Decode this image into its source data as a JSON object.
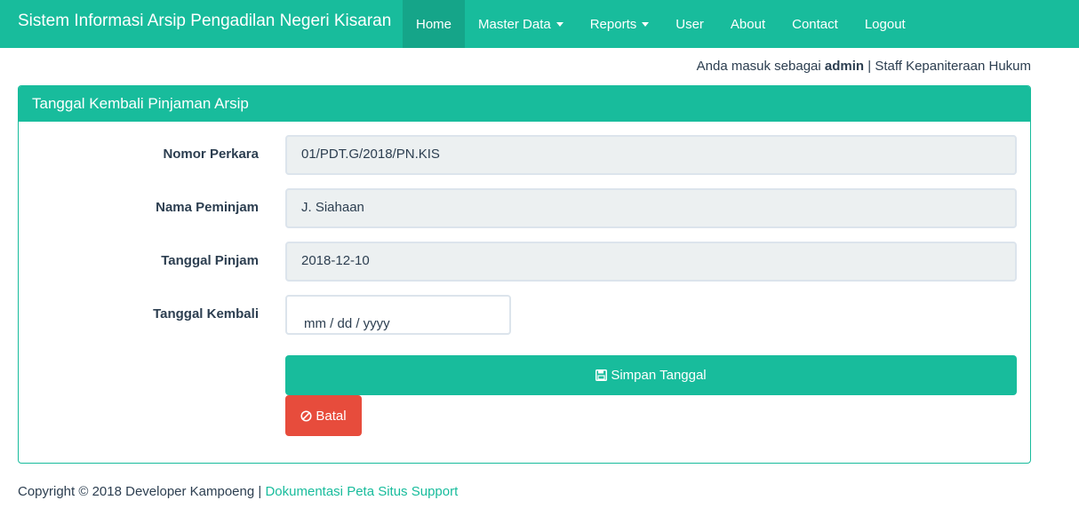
{
  "navbar": {
    "brand": "Sistem Informasi Arsip Pengadilan Negeri Kisaran",
    "items": [
      {
        "label": "Home",
        "active": true
      },
      {
        "label": "Master Data",
        "dropdown": true
      },
      {
        "label": "Reports",
        "dropdown": true
      },
      {
        "label": "User"
      },
      {
        "label": "About"
      },
      {
        "label": "Contact"
      },
      {
        "label": "Logout"
      }
    ]
  },
  "user": {
    "prefix": "Anda masuk sebagai",
    "name": "admin",
    "separator": "|",
    "role": "Staff Kepaniteraan Hukum"
  },
  "panel": {
    "title": "Tanggal Kembali Pinjaman Arsip",
    "fields": [
      {
        "label": "Nomor Perkara",
        "value": "01/PDT.G/2018/PN.KIS"
      },
      {
        "label": "Nama Peminjam",
        "value": "J. Siahaan"
      },
      {
        "label": "Tanggal Pinjam",
        "value": "2018-12-10"
      }
    ],
    "return_date": {
      "label": "Tanggal Kembali",
      "placeholder": "mm / dd / yyyy"
    },
    "save_button": {
      "label": "Simpan Tanggal",
      "icon": "floppy-disk-icon"
    },
    "cancel_button": {
      "label": "Batal",
      "icon": "ban-icon"
    }
  },
  "footer": {
    "copyright": "Copyright © 2018 Developer Kampoeng",
    "separator": "|",
    "links": [
      "Dokumentasi",
      "Peta Situs",
      "Support"
    ]
  },
  "colors": {
    "brand": "#18bc9c",
    "brand_active": "#15a589",
    "danger": "#e74c3c",
    "text": "#2c3e50",
    "readonly_bg": "#ecf0f1"
  }
}
